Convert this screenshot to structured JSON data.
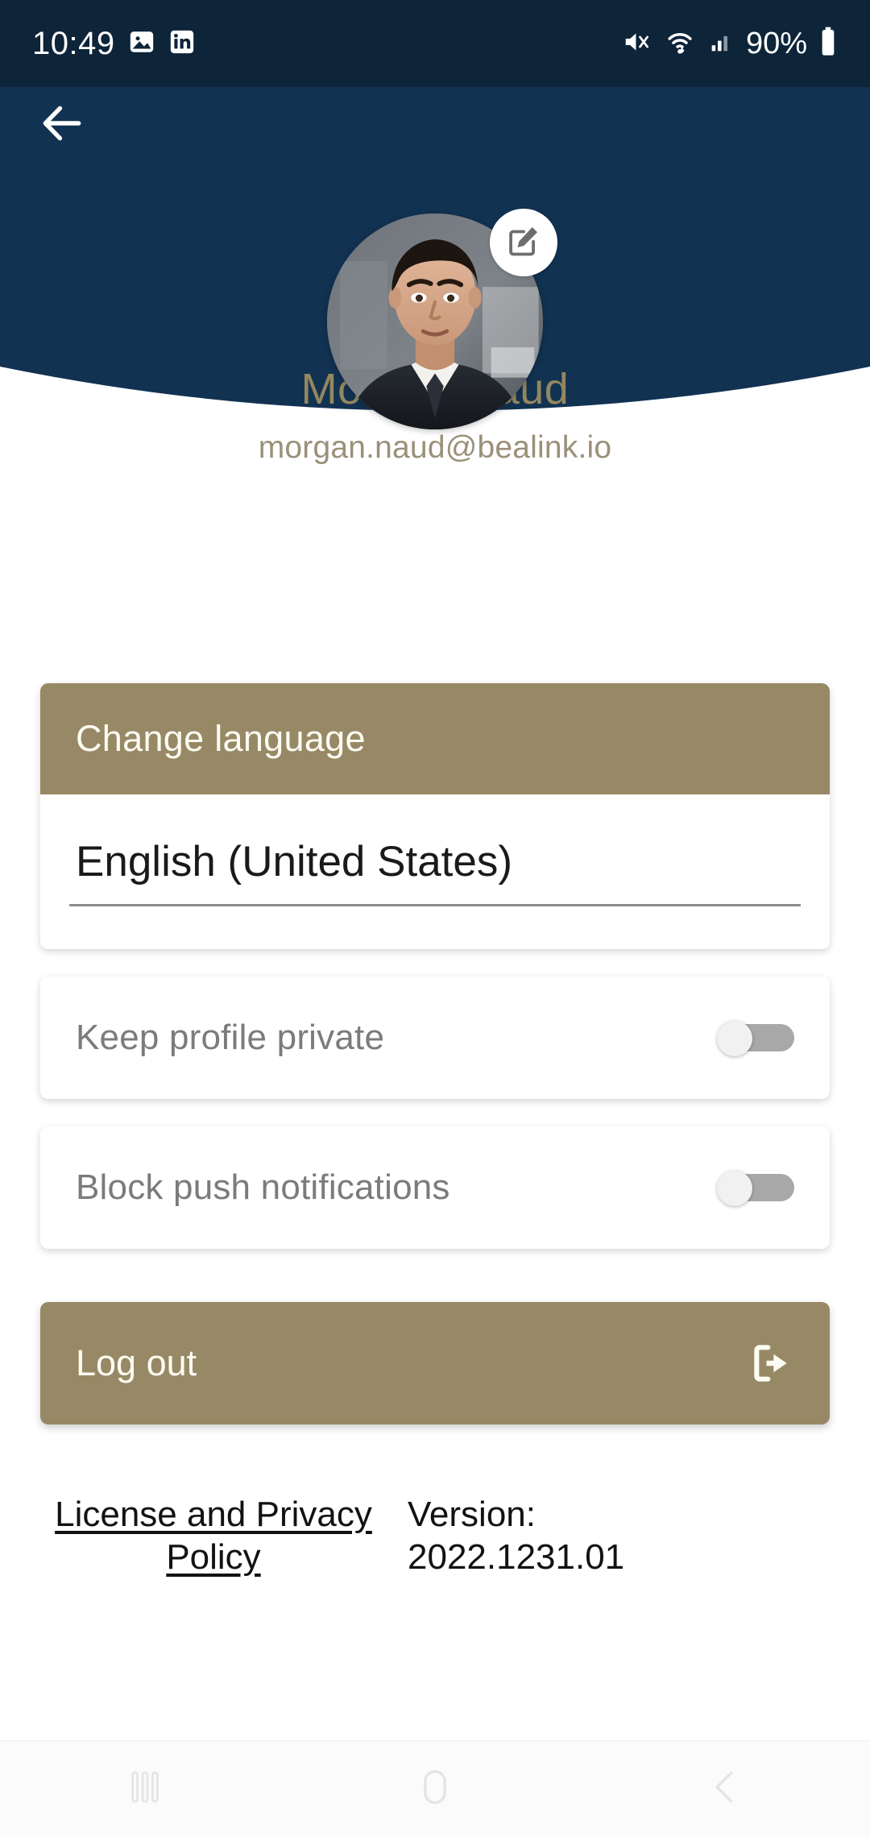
{
  "statusbar": {
    "time": "10:49",
    "battery_percent": "90%",
    "left_icons": [
      "photo-icon",
      "linkedin-icon"
    ],
    "right_icons": [
      "mute-icon",
      "wifi-icon",
      "cellular-signal-icon",
      "battery-icon"
    ]
  },
  "header": {
    "back_icon": "back-arrow-icon",
    "background_color": "#123252"
  },
  "profile": {
    "avatar_alt": "profile-photo",
    "edit_icon": "edit-pencil-icon",
    "name": "Morgan Naud",
    "email": "morgan.naud@bealink.io",
    "name_color": "#94875f"
  },
  "language_card": {
    "header_label": "Change language",
    "selected_value": "English (United States)",
    "accent_color": "#988966"
  },
  "toggles": [
    {
      "label": "Keep profile private",
      "state": "off"
    },
    {
      "label": "Block push notifications",
      "state": "off"
    }
  ],
  "logout": {
    "label": "Log out",
    "icon": "logout-icon",
    "background_color": "#988966"
  },
  "footer": {
    "license_link": "License and Privacy Policy",
    "version_label": "Version:",
    "version_value": "2022.1231.01"
  },
  "navbar": {
    "recents_icon": "recents-icon",
    "home_icon": "home-icon",
    "back_icon": "nav-back-icon"
  }
}
